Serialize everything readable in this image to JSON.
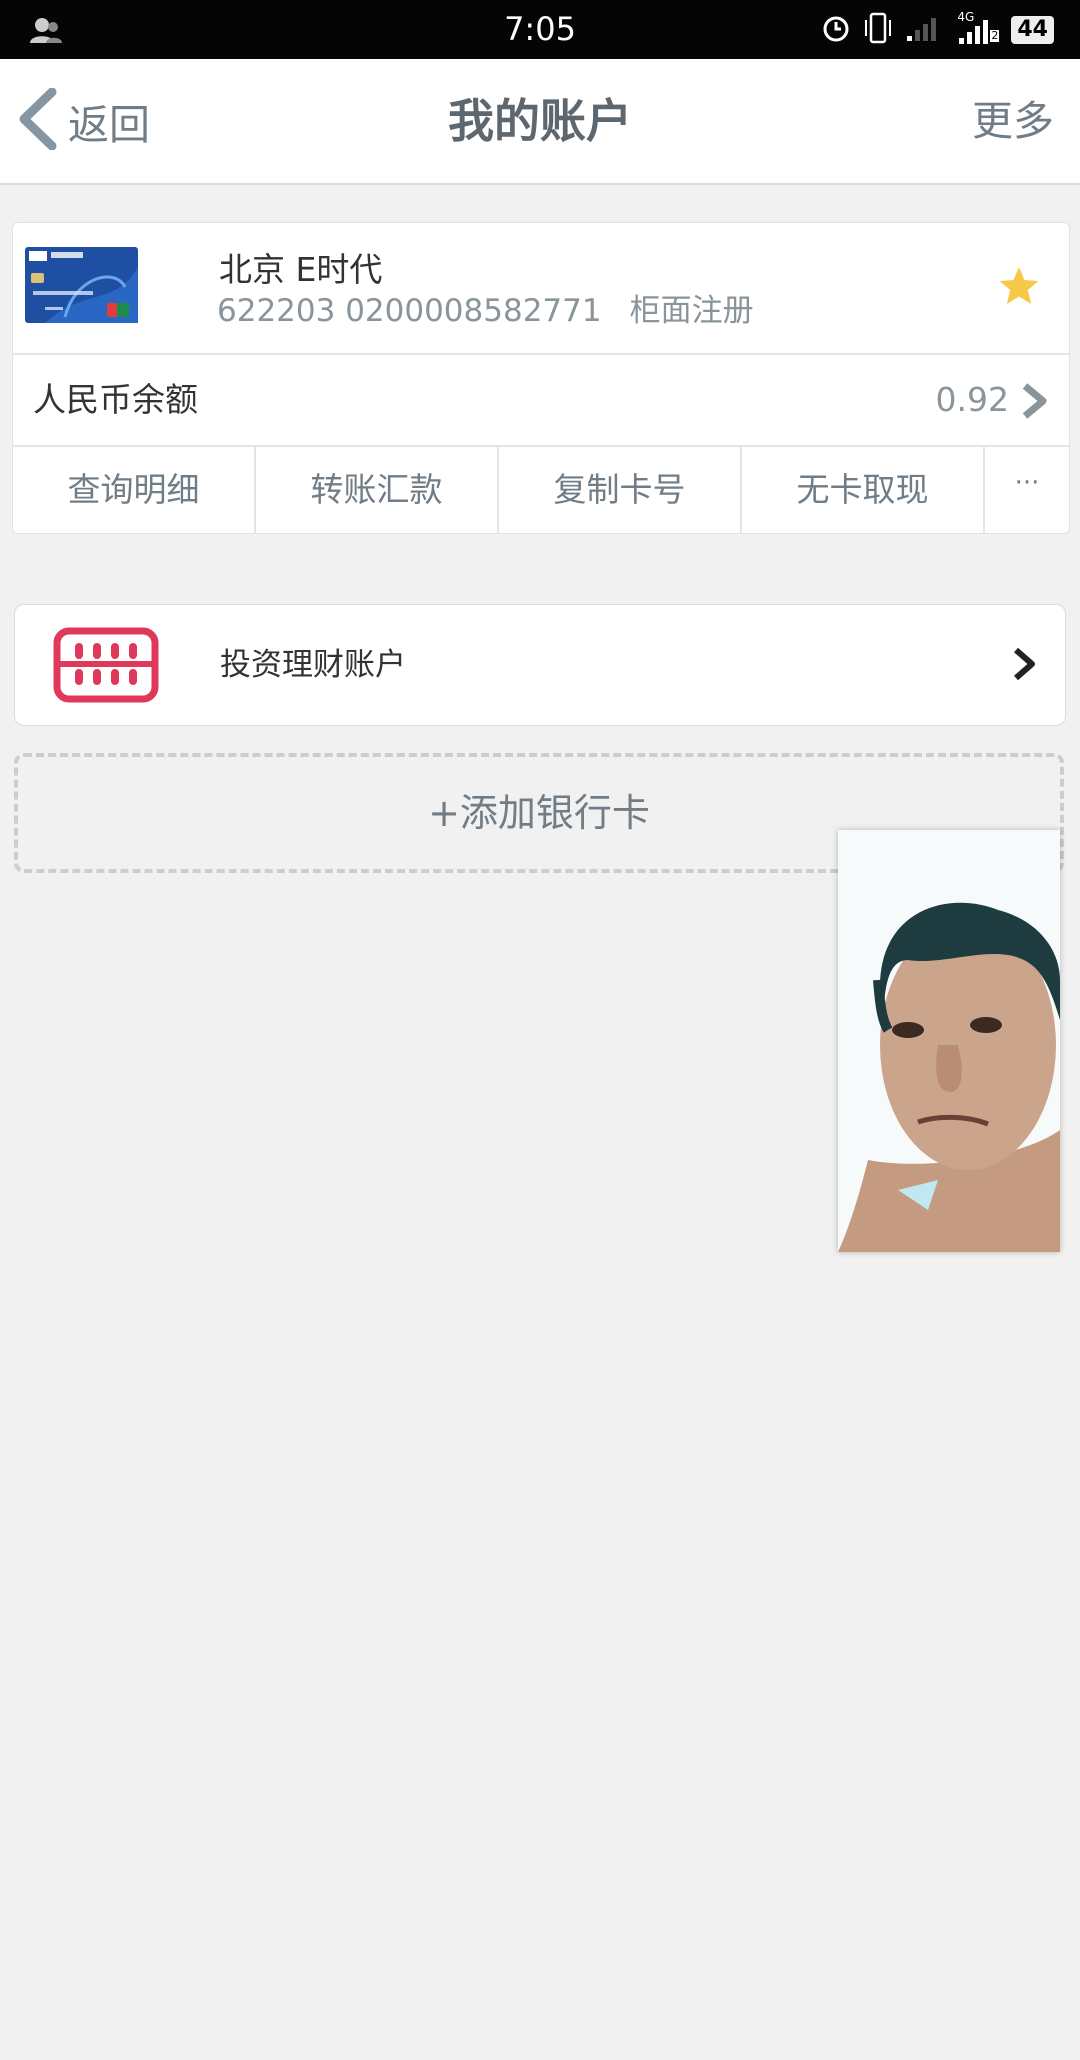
{
  "status_bar": {
    "time": "7:05",
    "network": "4G",
    "sim_slot": "2",
    "battery": "44"
  },
  "header": {
    "back_label": "返回",
    "title": "我的账户",
    "more_label": "更多"
  },
  "account_card": {
    "name": "北京 E时代",
    "number": "622203 0200008582771",
    "registration": "柜面注册",
    "favorite_color": "#f7c948"
  },
  "balance": {
    "label": "人民币余额",
    "value": "0.92"
  },
  "actions": [
    {
      "label": "查询明细"
    },
    {
      "label": "转账汇款"
    },
    {
      "label": "复制卡号"
    },
    {
      "label": "无卡取现"
    },
    {
      "label": "···"
    }
  ],
  "investment": {
    "label": "投资理财账户",
    "icon_color": "#e0385b"
  },
  "add_card": {
    "label": "+添加银行卡"
  },
  "colors": {
    "accent_gray": "#717d86",
    "background": "#f1f1f1"
  }
}
